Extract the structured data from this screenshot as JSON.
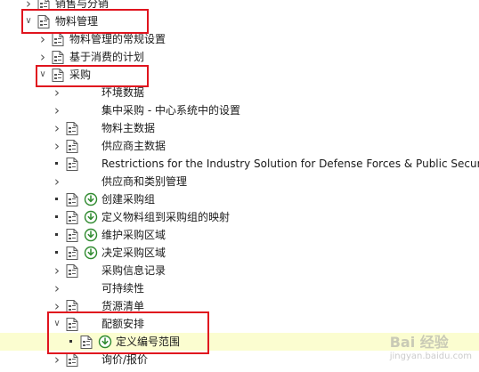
{
  "tree": [
    {
      "label": "销售与分销",
      "level": 0,
      "state": "collapsed",
      "icon": "doc",
      "exec": false,
      "name": "tree-item-sales-distribution",
      "y": 0
    },
    {
      "label": "物料管理",
      "level": 0,
      "state": "expanded",
      "icon": "doc",
      "exec": false,
      "name": "tree-item-materials-management",
      "y": 1
    },
    {
      "label": "物料管理的常规设置",
      "level": 1,
      "state": "collapsed",
      "icon": "doc",
      "exec": false,
      "name": "tree-item-mm-general-settings",
      "y": 2
    },
    {
      "label": "基于消费的计划",
      "level": 1,
      "state": "collapsed",
      "icon": "doc",
      "exec": false,
      "name": "tree-item-consumption-based-planning",
      "y": 3
    },
    {
      "label": "采购",
      "level": 1,
      "state": "expanded",
      "icon": "doc",
      "exec": false,
      "name": "tree-item-purchasing",
      "y": 4
    },
    {
      "label": "环境数据",
      "level": 2,
      "state": "collapsed",
      "icon": "none",
      "exec": false,
      "name": "tree-item-environment-data",
      "y": 5
    },
    {
      "label": "集中采购 - 中心系统中的设置",
      "level": 2,
      "state": "collapsed",
      "icon": "none",
      "exec": false,
      "name": "tree-item-central-purchasing",
      "y": 6
    },
    {
      "label": "物料主数据",
      "level": 2,
      "state": "collapsed",
      "icon": "doc",
      "exec": false,
      "name": "tree-item-material-master",
      "y": 7
    },
    {
      "label": "供应商主数据",
      "level": 2,
      "state": "collapsed",
      "icon": "doc",
      "exec": false,
      "name": "tree-item-vendor-master",
      "y": 8
    },
    {
      "label": "Restrictions for the Industry Solution for Defense Forces & Public Security",
      "level": 2,
      "state": "leaf",
      "icon": "doc",
      "exec": false,
      "name": "tree-item-restrictions-defense",
      "y": 9
    },
    {
      "label": "供应商和类别管理",
      "level": 2,
      "state": "collapsed",
      "icon": "none",
      "exec": false,
      "name": "tree-item-supplier-category-mgmt",
      "y": 10
    },
    {
      "label": "创建采购组",
      "level": 2,
      "state": "leaf",
      "icon": "doc",
      "exec": true,
      "name": "tree-item-create-purchasing-groups",
      "y": 11
    },
    {
      "label": "定义物料组到采购组的映射",
      "level": 2,
      "state": "leaf",
      "icon": "doc",
      "exec": true,
      "name": "tree-item-material-group-mapping",
      "y": 12
    },
    {
      "label": "维护采购区域",
      "level": 2,
      "state": "leaf",
      "icon": "doc",
      "exec": true,
      "name": "tree-item-maintain-purchasing-areas",
      "y": 13
    },
    {
      "label": "决定采购区域",
      "level": 2,
      "state": "leaf",
      "icon": "doc",
      "exec": true,
      "name": "tree-item-determine-purchasing-areas",
      "y": 14
    },
    {
      "label": "采购信息记录",
      "level": 2,
      "state": "collapsed",
      "icon": "doc",
      "exec": false,
      "name": "tree-item-purchasing-info-record",
      "y": 15
    },
    {
      "label": "可持续性",
      "level": 2,
      "state": "collapsed",
      "icon": "none",
      "exec": false,
      "name": "tree-item-sustainability",
      "y": 16
    },
    {
      "label": "货源清单",
      "level": 2,
      "state": "collapsed",
      "icon": "doc",
      "exec": false,
      "name": "tree-item-source-list",
      "y": 17
    },
    {
      "label": "配额安排",
      "level": 2,
      "state": "expanded",
      "icon": "doc",
      "exec": false,
      "name": "tree-item-quota-arrangement",
      "y": 18
    },
    {
      "label": "定义编号范围",
      "level": 3,
      "state": "leaf",
      "icon": "doc",
      "exec": true,
      "selected": true,
      "name": "tree-item-define-number-ranges",
      "y": 19
    },
    {
      "label": "询价/报价",
      "level": 2,
      "state": "collapsed",
      "icon": "doc",
      "exec": false,
      "name": "tree-item-rfq-quotation",
      "y": 20
    }
  ],
  "highlights": [
    {
      "name": "highlight-materials-management",
      "target": "物料管理"
    },
    {
      "name": "highlight-purchasing",
      "target": "采购"
    },
    {
      "name": "highlight-quota-arrangement",
      "target": "配额安排 / 定义编号范围"
    }
  ],
  "colors": {
    "selection_bg": "#fbfdd0",
    "highlight_border": "#e0141e",
    "exec_icon": "#2f8a2f"
  },
  "watermark": {
    "brand": "Bai 经验",
    "sub": "jingyan.baidu.com"
  }
}
